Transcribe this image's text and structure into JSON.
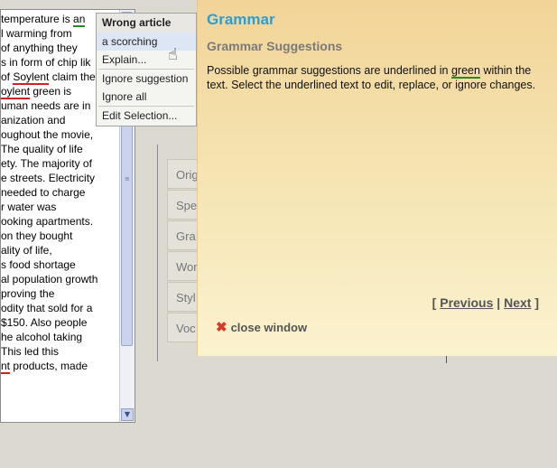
{
  "editor": {
    "lines": [
      {
        "pre": "temperature is ",
        "mark": "an",
        "post": "",
        "underline": "green"
      },
      {
        "pre": "l warming from",
        "mark": "",
        "post": "",
        "underline": ""
      },
      {
        "pre": "of anything they",
        "mark": "",
        "post": "",
        "underline": ""
      },
      {
        "pre": "s in form of chip lik",
        "mark": "",
        "post": "",
        "underline": ""
      },
      {
        "pre": "of ",
        "mark": "Soylent",
        "post": " claim the",
        "underline": "red"
      },
      {
        "pre": "",
        "mark": "oylent",
        "post": " green is",
        "underline": "red"
      },
      {
        "pre": "uman needs are in",
        "mark": "",
        "post": "",
        "underline": ""
      },
      {
        "pre": "anization and",
        "mark": "",
        "post": "",
        "underline": ""
      },
      {
        "pre": "oughout the movie,",
        "mark": "",
        "post": "",
        "underline": ""
      },
      {
        "pre": "The quality of life",
        "mark": "",
        "post": "",
        "underline": ""
      },
      {
        "pre": "ety. The majority of",
        "mark": "",
        "post": "",
        "underline": ""
      },
      {
        "pre": "e streets. Electricity",
        "mark": "",
        "post": "",
        "underline": ""
      },
      {
        "pre": " needed to charge",
        "mark": "",
        "post": "",
        "underline": ""
      },
      {
        "pre": "r water was",
        "mark": "",
        "post": "",
        "underline": ""
      },
      {
        "pre": "ooking apartments.",
        "mark": "",
        "post": "",
        "underline": ""
      },
      {
        "pre": "on they bought",
        "mark": "",
        "post": "",
        "underline": ""
      },
      {
        "pre": "ality of life,",
        "mark": "",
        "post": "",
        "underline": ""
      },
      {
        "pre": "s food shortage",
        "mark": "",
        "post": "",
        "underline": ""
      },
      {
        "pre": "al population growth",
        "mark": "",
        "post": "",
        "underline": ""
      },
      {
        "pre": "proving the",
        "mark": "",
        "post": "",
        "underline": ""
      },
      {
        "pre": "odity that sold for a",
        "mark": "",
        "post": "",
        "underline": ""
      },
      {
        "pre": "$150.  Also people",
        "mark": "",
        "post": "",
        "underline": ""
      },
      {
        "pre": "he alcohol taking",
        "mark": "",
        "post": "",
        "underline": ""
      },
      {
        "pre": "This led this",
        "mark": "",
        "post": "",
        "underline": ""
      },
      {
        "pre": "",
        "mark": "nt",
        "post": " products, made",
        "underline": "red"
      }
    ],
    "scroll_down_glyph": "▼"
  },
  "context_menu": {
    "title": "Wrong article",
    "suggestion": "a scorching",
    "explain": "Explain...",
    "ignore_suggestion": "Ignore suggestion",
    "ignore_all": "Ignore all",
    "edit_selection": "Edit Selection..."
  },
  "tabs": [
    {
      "label": "Orig"
    },
    {
      "label": "Spe"
    },
    {
      "label": "Gra"
    },
    {
      "label": "Wor"
    },
    {
      "label": "Styl"
    },
    {
      "label": "Voc"
    }
  ],
  "help": {
    "title": "Grammar",
    "subtitle": "Grammar Suggestions",
    "body_pre": "Possible grammar suggestions are underlined in ",
    "body_green": "green",
    "body_post": " within the text. Select the underlined text to edit, replace, or ignore changes.",
    "pager_open": "[",
    "previous": "Previous",
    "pager_sep": "|",
    "next": "Next",
    "pager_close": "]",
    "close_label": "close window",
    "close_glyph": "✖"
  },
  "colors": {
    "title_blue": "#2a9fd6",
    "grammar_green": "#2a8a22",
    "spelling_red": "#d62020"
  }
}
